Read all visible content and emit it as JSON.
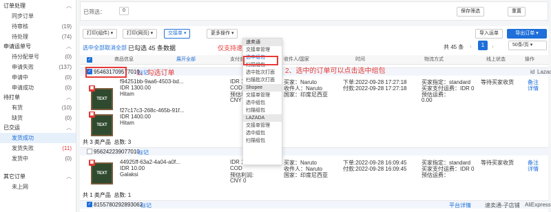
{
  "sidebar": {
    "groups": [
      {
        "label": "订单处理",
        "items": [
          {
            "label": "同步订单",
            "count": ""
          },
          {
            "label": "待审核",
            "count": "(19)"
          },
          {
            "label": "待处理",
            "count": "(74)"
          },
          {
            "label": "申请运单号",
            "count": ""
          },
          {
            "label": "待分配单号",
            "count": "(0)"
          },
          {
            "label": "申请失败",
            "count": "(137)"
          },
          {
            "label": "申请中",
            "count": "(0)"
          },
          {
            "label": "申请成功",
            "count": "(0)"
          },
          {
            "label": "待打单",
            "count": ""
          },
          {
            "label": "有货",
            "count": "(10)"
          },
          {
            "label": "缺货",
            "count": "(0)"
          },
          {
            "label": "已交运",
            "count": ""
          },
          {
            "label": "发货成功",
            "count": ""
          },
          {
            "label": "发货失败",
            "count": "(11)"
          },
          {
            "label": "发货中",
            "count": "(0)"
          }
        ]
      },
      {
        "label": "其它订单",
        "items": [
          {
            "label": "未上网",
            "count": ""
          }
        ]
      }
    ]
  },
  "filter": {
    "label": "已筛选：",
    "value": "0",
    "save": "保存筛选",
    "reset": "重置"
  },
  "toolbar": {
    "print_label": "打印(组件)",
    "print_web": "打印(网页)",
    "exchange": "交接单",
    "more": "更多操作",
    "select_all": "选中全部",
    "cancel_all": "取消全部",
    "selected": "已勾选 45 条数据",
    "notice": "仅支持速卖通组包功能",
    "import": "导入运单",
    "export": "导出订单",
    "total": "共 45 条",
    "page": "1",
    "per_page": "50条/页"
  },
  "columns": [
    "商品信息",
    "支付金额",
    "收件人/国家",
    "时间",
    "物流方式",
    "线上状态",
    "操作"
  ],
  "extra_col": "展开全部",
  "dropdown": {
    "sections": [
      {
        "title": "速卖通",
        "items": [
          "交接单管理",
          "选中组包",
          "扫描组包",
          "选中批次打面",
          "扫描批次打面"
        ]
      },
      {
        "title": "Shopee",
        "items": [
          "交接单管理",
          "选中组包",
          "扫描组包"
        ]
      },
      {
        "title": "LAZADA",
        "items": [
          "交接单管理",
          "选中组包",
          "扫描组包"
        ]
      }
    ]
  },
  "annotations": {
    "step1": "1、勾选订单",
    "step2": "2、选中的订单可以点击选中组包"
  },
  "orders": [
    {
      "no": "954631709577010",
      "tag": "标记",
      "shop": "Lazada",
      "shop_prefix": "id",
      "products": [
        {
          "sku": "f94251bb-9aa6-4503-bd...",
          "price": "IDR 1300.00",
          "name": "Hitam"
        },
        {
          "sku": "f27c17c3-268c-465b-91f...",
          "price": "IDR 1400.00",
          "name": "Hitam"
        }
      ],
      "amount": [
        "IDR 1002700.00",
        "COD",
        "预估利润:",
        "CNY 0"
      ],
      "buyer": [
        "买家：Naruto",
        "收件人：Naruto",
        "国家：印度尼西亚"
      ],
      "time": [
        "下单:2022-09-28 17:27:18",
        "付款:2022-09-28 17:27:18"
      ],
      "logistics": [
        "买家指定：standard",
        "买家支付运费：IDR 0",
        "预估运费：",
        "0.00"
      ],
      "status": "等待买家收货",
      "ops": [
        "备注",
        "详情"
      ],
      "footer": [
        "共 3 类产品",
        "总数: 3"
      ]
    },
    {
      "no": "956242239077010",
      "tag": "标记",
      "shop": "",
      "products": [
        {
          "sku": "44925ff-63a2-4a04-a0f...",
          "price": "IDR 10.00",
          "name": "Galaksi"
        }
      ],
      "amount": [
        "IDR 10.00",
        "COD",
        "预估利润:",
        "CNY 0"
      ],
      "buyer": [
        "买家：Naruto",
        "收件人：Naruto",
        "国家：印度尼西亚"
      ],
      "time": [
        "下单:2022-09-28 16:09:45",
        "付款:2022-09-28 16:09:45"
      ],
      "logistics": [
        "买家指定：standard",
        "买家支付运费：IDR 0",
        "预估运费："
      ],
      "status": "等待买家收货",
      "ops": [
        "备注",
        "详情"
      ],
      "footer": [
        "共 1 类产品",
        "总数: 1"
      ]
    },
    {
      "no": "8155780292893062",
      "tag": "标记",
      "shop": "AliExpress",
      "logistics_link": "平台详情",
      "logistics_name": "速卖通-子店铺"
    }
  ]
}
